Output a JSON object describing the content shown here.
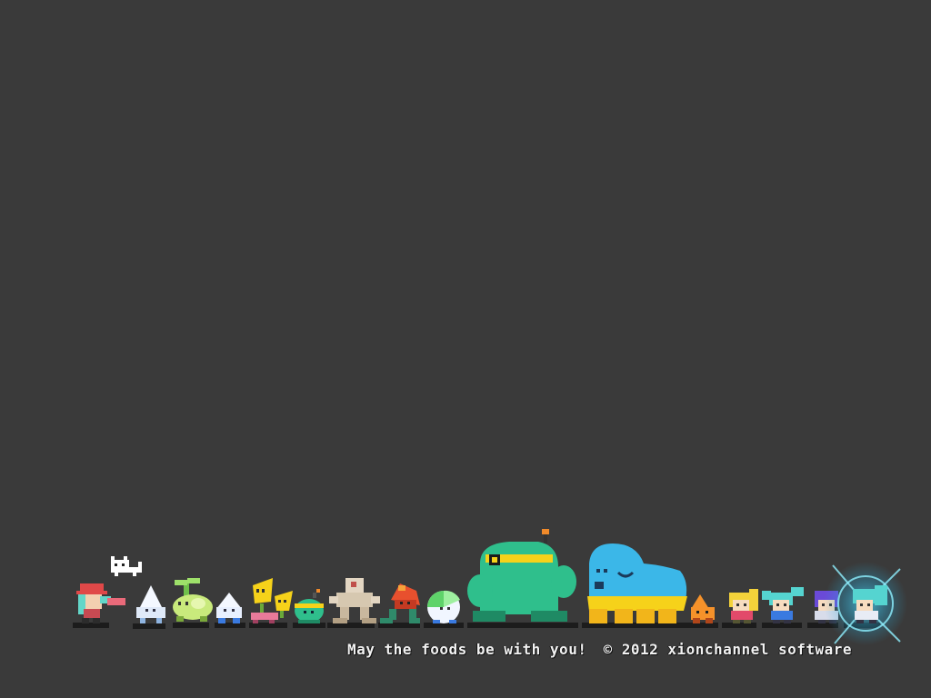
{
  "scene": {
    "background": "#3a3a3a",
    "footer": {
      "tagline": "May the foods be with you!",
      "copyright": "© 2012 xionchannel software"
    },
    "characters": [
      {
        "name": "red-hat-girl-character-icon"
      },
      {
        "name": "white-cat-icon"
      },
      {
        "name": "white-drop-ghost-icon"
      },
      {
        "name": "green-melon-sprout-icon"
      },
      {
        "name": "small-white-blob-icon"
      },
      {
        "name": "yellow-leaf-creature-icon"
      },
      {
        "name": "small-yellow-leaf-icon"
      },
      {
        "name": "green-antenna-blob-icon"
      },
      {
        "name": "beige-stone-golem-icon"
      },
      {
        "name": "red-mushroom-walker-icon"
      },
      {
        "name": "green-white-egg-icon"
      },
      {
        "name": "big-green-monster-icon"
      },
      {
        "name": "big-blue-yellow-monster-icon"
      },
      {
        "name": "orange-flame-kid-icon"
      },
      {
        "name": "blonde-hair-girl-icon"
      },
      {
        "name": "cyan-twin-tail-girl-icon"
      },
      {
        "name": "purple-hair-girl-icon"
      },
      {
        "name": "cyan-hair-girl-glow-icon"
      }
    ],
    "colors": {
      "big_green": "#2fbf8c",
      "big_blue": "#3bb7e8",
      "yellow": "#f6d21a",
      "glow": "#4fe0ff",
      "shadow": "#1b1b1b"
    }
  }
}
